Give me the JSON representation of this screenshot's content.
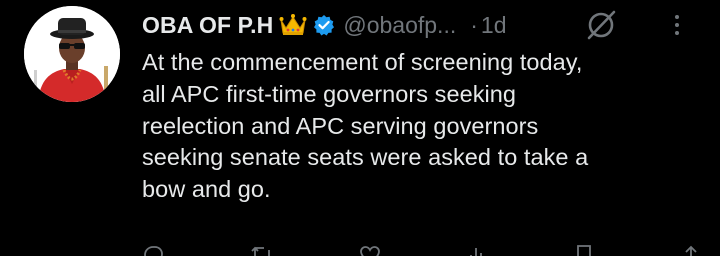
{
  "tweet": {
    "display_name": "OBA OF P.H",
    "handle": "@obaofp...",
    "separator": "·",
    "time": "1d",
    "text_lines": [
      "At the commencement of screening today,",
      "all APC first-time governors seeking",
      "reelection and APC serving governors",
      "seeking senate seats were asked to take a",
      "bow and go."
    ]
  },
  "icons": {
    "crown": "crown-emoji-icon",
    "verified": "verified-badge-icon",
    "grok": "grok-icon",
    "more": "more-options-icon",
    "reply": "reply-icon",
    "repost": "repost-icon",
    "like": "like-icon",
    "views": "views-icon",
    "bookmark": "bookmark-icon",
    "share": "share-icon"
  },
  "colors": {
    "background": "#000000",
    "text": "#e7e9ea",
    "muted": "#71767b",
    "verified": "#1d9bf0",
    "crown": "#f5b800"
  }
}
